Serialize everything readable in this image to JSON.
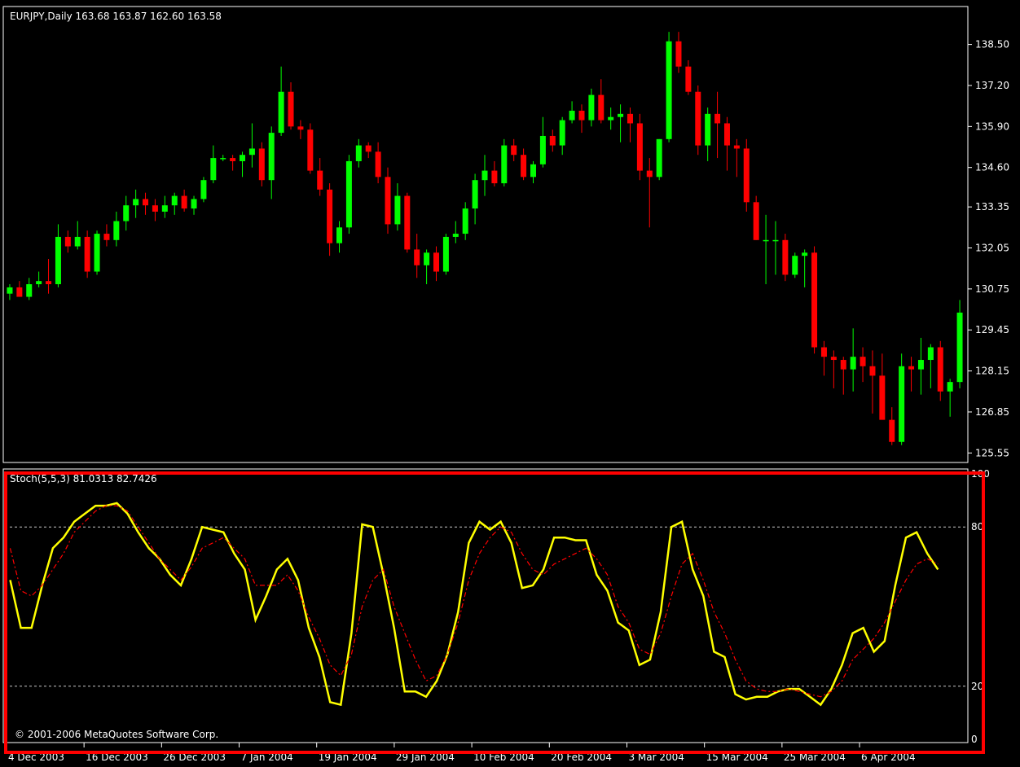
{
  "header": {
    "symbol_line": "EURJPY,Daily  163.68 163.87 162.60 163.58",
    "indicator_line": "Stoch(5,5,3) 81.0313 82.7426",
    "copyright": "© 2001-2006 MetaQuotes Software Corp."
  },
  "colors": {
    "background": "#000000",
    "frame": "#ffffff",
    "bull": "#00ff00",
    "bear": "#ff0000",
    "main_line": "#ffff00",
    "signal_line": "#ff0000",
    "highlight": "#ff0000"
  },
  "chart_data": [
    {
      "type": "candlestick",
      "title": "EURJPY,Daily  163.68 163.87 162.60 163.58",
      "ylim": [
        125.3,
        139.6
      ],
      "y_ticks": [
        "138.50",
        "137.20",
        "135.90",
        "134.60",
        "133.35",
        "132.05",
        "130.75",
        "129.45",
        "128.15",
        "126.85",
        "125.55"
      ],
      "y_tick_values": [
        138.5,
        137.2,
        135.9,
        134.6,
        133.35,
        132.05,
        130.75,
        129.45,
        128.15,
        126.85,
        125.55
      ],
      "x_ticks": [
        "4 Dec 2003",
        "16 Dec 2003",
        "26 Dec 2003",
        "7 Jan 2004",
        "19 Jan 2004",
        "29 Jan 2004",
        "10 Feb 2004",
        "20 Feb 2004",
        "3 Mar 2004",
        "15 Mar 2004",
        "25 Mar 2004",
        "6 Apr 2004"
      ],
      "x_tick_indices": [
        0,
        8,
        16,
        24,
        32,
        40,
        48,
        56,
        64,
        72,
        80,
        88
      ],
      "candles": [
        [
          130.6,
          130.9,
          130.4,
          130.8
        ],
        [
          130.8,
          131.0,
          130.5,
          130.5
        ],
        [
          130.5,
          131.1,
          130.4,
          130.9
        ],
        [
          130.9,
          131.3,
          130.8,
          131.0
        ],
        [
          131.0,
          131.7,
          130.6,
          130.9
        ],
        [
          130.9,
          132.8,
          130.8,
          132.4
        ],
        [
          132.4,
          132.6,
          131.9,
          132.1
        ],
        [
          132.1,
          132.9,
          132.0,
          132.4
        ],
        [
          132.4,
          132.6,
          131.1,
          131.3
        ],
        [
          131.3,
          132.6,
          131.2,
          132.5
        ],
        [
          132.5,
          132.8,
          132.1,
          132.3
        ],
        [
          132.3,
          133.2,
          132.1,
          132.9
        ],
        [
          132.9,
          133.7,
          132.6,
          133.4
        ],
        [
          133.4,
          133.9,
          133.0,
          133.6
        ],
        [
          133.6,
          133.8,
          133.1,
          133.4
        ],
        [
          133.4,
          133.6,
          132.9,
          133.2
        ],
        [
          133.2,
          133.7,
          133.0,
          133.4
        ],
        [
          133.4,
          133.8,
          133.1,
          133.7
        ],
        [
          133.7,
          133.9,
          133.2,
          133.3
        ],
        [
          133.3,
          133.7,
          133.1,
          133.6
        ],
        [
          133.6,
          134.3,
          133.5,
          134.2
        ],
        [
          134.2,
          135.3,
          134.1,
          134.9
        ],
        [
          134.9,
          135.0,
          134.8,
          134.9
        ],
        [
          134.9,
          135.0,
          134.5,
          134.8
        ],
        [
          134.8,
          135.1,
          134.3,
          135.0
        ],
        [
          135.0,
          136.0,
          134.6,
          135.2
        ],
        [
          135.2,
          135.4,
          134.0,
          134.2
        ],
        [
          134.2,
          135.9,
          133.6,
          135.7
        ],
        [
          135.7,
          137.8,
          135.6,
          137.0
        ],
        [
          137.0,
          137.3,
          135.8,
          135.9
        ],
        [
          135.9,
          136.1,
          135.5,
          135.8
        ],
        [
          135.8,
          136.0,
          134.4,
          134.5
        ],
        [
          134.5,
          134.9,
          133.7,
          133.9
        ],
        [
          133.9,
          134.1,
          131.8,
          132.2
        ],
        [
          132.2,
          132.9,
          131.9,
          132.7
        ],
        [
          132.7,
          135.0,
          132.5,
          134.8
        ],
        [
          134.8,
          135.5,
          134.6,
          135.3
        ],
        [
          135.3,
          135.4,
          134.9,
          135.1
        ],
        [
          135.1,
          135.4,
          134.1,
          134.3
        ],
        [
          134.3,
          134.6,
          132.5,
          132.8
        ],
        [
          132.8,
          134.1,
          132.6,
          133.7
        ],
        [
          133.7,
          133.8,
          131.9,
          132.0
        ],
        [
          132.0,
          132.5,
          131.1,
          131.5
        ],
        [
          131.5,
          132.0,
          130.9,
          131.9
        ],
        [
          131.9,
          132.1,
          131.0,
          131.3
        ],
        [
          131.3,
          132.5,
          131.2,
          132.4
        ],
        [
          132.4,
          132.9,
          132.2,
          132.5
        ],
        [
          132.5,
          133.5,
          132.3,
          133.3
        ],
        [
          133.3,
          134.4,
          132.8,
          134.2
        ],
        [
          134.2,
          135.0,
          133.7,
          134.5
        ],
        [
          134.5,
          134.8,
          134.0,
          134.1
        ],
        [
          134.1,
          135.5,
          134.0,
          135.3
        ],
        [
          135.3,
          135.5,
          134.8,
          135.0
        ],
        [
          135.0,
          135.2,
          134.2,
          134.3
        ],
        [
          134.3,
          134.8,
          134.1,
          134.7
        ],
        [
          134.7,
          136.2,
          134.6,
          135.6
        ],
        [
          135.6,
          135.8,
          135.1,
          135.3
        ],
        [
          135.3,
          136.2,
          135.0,
          136.1
        ],
        [
          136.1,
          136.7,
          136.0,
          136.4
        ],
        [
          136.4,
          136.6,
          135.7,
          136.1
        ],
        [
          136.1,
          137.1,
          135.9,
          136.9
        ],
        [
          136.9,
          137.4,
          136.0,
          136.1
        ],
        [
          136.1,
          136.5,
          135.8,
          136.2
        ],
        [
          136.2,
          136.6,
          135.4,
          136.3
        ],
        [
          136.3,
          136.5,
          135.4,
          136.0
        ],
        [
          136.0,
          136.3,
          134.2,
          134.5
        ],
        [
          134.5,
          134.9,
          132.7,
          134.3
        ],
        [
          134.3,
          135.5,
          134.2,
          135.5
        ],
        [
          135.5,
          138.9,
          135.4,
          138.6
        ],
        [
          138.6,
          138.9,
          137.6,
          137.8
        ],
        [
          137.8,
          138.0,
          136.9,
          137.0
        ],
        [
          137.0,
          137.2,
          135.0,
          135.3
        ],
        [
          135.3,
          136.5,
          134.8,
          136.3
        ],
        [
          136.3,
          137.0,
          134.9,
          136.0
        ],
        [
          136.0,
          136.2,
          134.5,
          135.3
        ],
        [
          135.3,
          135.5,
          134.3,
          135.2
        ],
        [
          135.2,
          135.5,
          133.2,
          133.5
        ],
        [
          133.5,
          133.7,
          132.3,
          132.3
        ],
        [
          132.3,
          133.1,
          130.9,
          132.3
        ],
        [
          132.3,
          132.9,
          131.2,
          132.3
        ],
        [
          132.3,
          132.5,
          131.0,
          131.2
        ],
        [
          131.2,
          131.9,
          131.1,
          131.8
        ],
        [
          131.8,
          132.0,
          130.8,
          131.9
        ],
        [
          131.9,
          132.1,
          128.7,
          128.9
        ],
        [
          128.9,
          129.1,
          128.0,
          128.6
        ],
        [
          128.6,
          128.8,
          127.6,
          128.5
        ],
        [
          128.5,
          128.6,
          127.4,
          128.2
        ],
        [
          128.2,
          129.5,
          127.5,
          128.6
        ],
        [
          128.6,
          128.9,
          127.8,
          128.3
        ],
        [
          128.3,
          128.8,
          126.8,
          128.0
        ],
        [
          128.0,
          128.7,
          126.8,
          126.6
        ],
        [
          126.6,
          127.0,
          125.8,
          125.9
        ],
        [
          125.9,
          128.7,
          125.8,
          128.3
        ],
        [
          128.3,
          128.6,
          127.5,
          128.2
        ],
        [
          128.2,
          129.2,
          127.4,
          128.5
        ],
        [
          128.5,
          129.0,
          127.6,
          128.9
        ],
        [
          128.9,
          129.1,
          127.2,
          127.5
        ],
        [
          127.5,
          127.9,
          126.7,
          127.8
        ],
        [
          127.8,
          130.4,
          127.6,
          130.0
        ]
      ]
    },
    {
      "type": "line",
      "title": "Stoch(5,5,3) 81.0313 82.7426",
      "ylim": [
        0,
        100
      ],
      "y_ticks": [
        "100",
        "80",
        "20",
        "0"
      ],
      "y_tick_values": [
        100,
        80,
        20,
        0
      ],
      "levels": [
        80,
        20
      ],
      "series": [
        {
          "name": "main",
          "values": [
            60,
            42,
            42,
            58,
            72,
            76,
            82,
            85,
            88,
            88,
            89,
            85,
            78,
            72,
            68,
            62,
            58,
            68,
            80,
            79,
            78,
            70,
            64,
            45,
            54,
            64,
            68,
            60,
            42,
            31,
            14,
            13,
            40,
            81,
            80,
            62,
            42,
            18,
            18,
            16,
            22,
            32,
            48,
            74,
            82,
            79,
            82,
            74,
            57,
            58,
            64,
            76,
            76,
            75,
            75,
            62,
            56,
            44,
            41,
            28,
            30,
            48,
            80,
            82,
            64,
            54,
            33,
            31,
            17,
            15,
            16,
            16,
            18,
            19,
            19,
            16,
            13,
            19,
            28,
            40,
            42,
            33,
            37,
            58,
            76,
            78,
            70,
            64
          ],
          "x": [
            0,
            1,
            2,
            3,
            4,
            5,
            6,
            7,
            8,
            9,
            10,
            11,
            12,
            13,
            14,
            15,
            16,
            17,
            18,
            19,
            20,
            21,
            22,
            23,
            24,
            25,
            26,
            27,
            28,
            29,
            30,
            31,
            32,
            33,
            34,
            35,
            36,
            37,
            38,
            39,
            40,
            41,
            42,
            43,
            44,
            45,
            46,
            47,
            48,
            49,
            50,
            51,
            52,
            53,
            54,
            55,
            56,
            57,
            58,
            59,
            60,
            61,
            62,
            63,
            64,
            65,
            66,
            67,
            68,
            69,
            70,
            71,
            72,
            73,
            74,
            75,
            76,
            77,
            78,
            79,
            80,
            81,
            82,
            83,
            84,
            85,
            86,
            87
          ]
        },
        {
          "name": "signal",
          "values": [
            72,
            56,
            54,
            58,
            64,
            70,
            78,
            82,
            86,
            88,
            88,
            86,
            80,
            74,
            68,
            64,
            60,
            65,
            72,
            74,
            76,
            72,
            68,
            58,
            58,
            58,
            62,
            56,
            46,
            38,
            28,
            24,
            32,
            50,
            60,
            64,
            50,
            40,
            30,
            22,
            24,
            32,
            44,
            60,
            70,
            76,
            80,
            78,
            70,
            64,
            62,
            66,
            68,
            70,
            72,
            68,
            62,
            50,
            44,
            34,
            32,
            40,
            54,
            66,
            70,
            60,
            48,
            40,
            30,
            22,
            19,
            18,
            18,
            19,
            18,
            17,
            16,
            18,
            22,
            30,
            34,
            38,
            44,
            52,
            60,
            66,
            68,
            66
          ],
          "x": [
            0,
            1,
            2,
            3,
            4,
            5,
            6,
            7,
            8,
            9,
            10,
            11,
            12,
            13,
            14,
            15,
            16,
            17,
            18,
            19,
            20,
            21,
            22,
            23,
            24,
            25,
            26,
            27,
            28,
            29,
            30,
            31,
            32,
            33,
            34,
            35,
            36,
            37,
            38,
            39,
            40,
            41,
            42,
            43,
            44,
            45,
            46,
            47,
            48,
            49,
            50,
            51,
            52,
            53,
            54,
            55,
            56,
            57,
            58,
            59,
            60,
            61,
            62,
            63,
            64,
            65,
            66,
            67,
            68,
            69,
            70,
            71,
            72,
            73,
            74,
            75,
            76,
            77,
            78,
            79,
            80,
            81,
            82,
            83,
            84,
            85,
            86,
            87
          ]
        }
      ]
    }
  ]
}
